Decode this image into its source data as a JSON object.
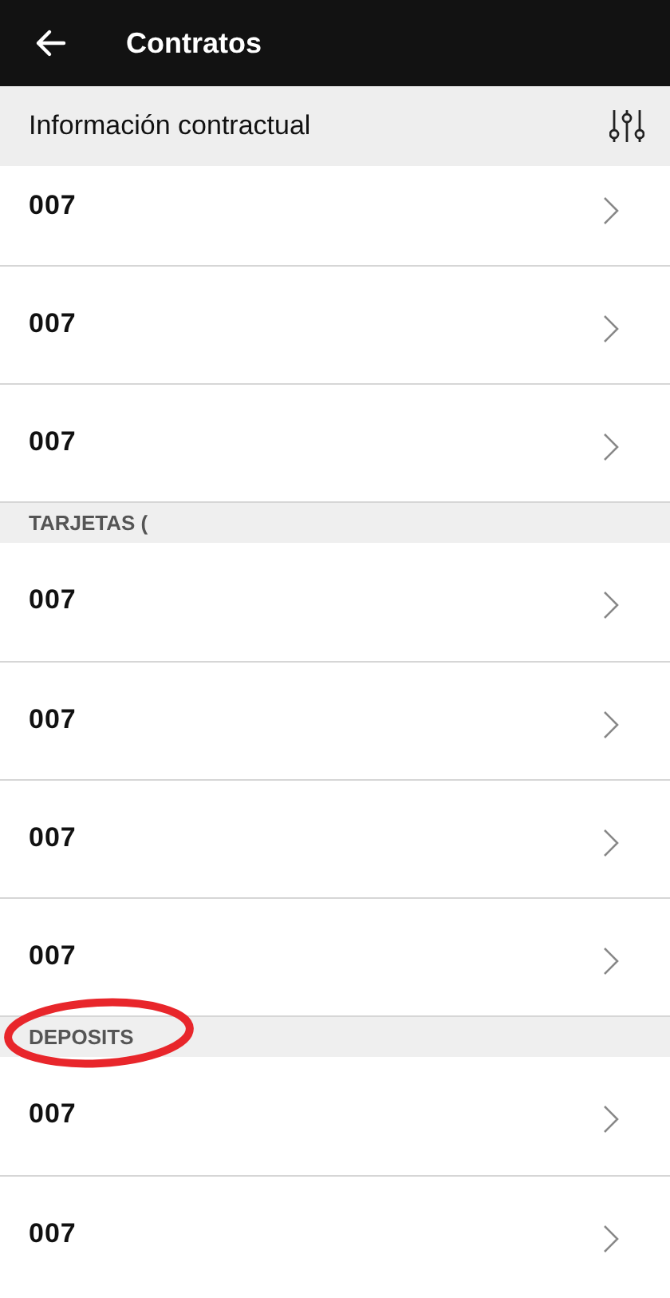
{
  "app_bar": {
    "title": "Contratos"
  },
  "subheader": {
    "title": "Información contractual"
  },
  "groups": [
    {
      "highlighted": false,
      "rows": [
        {
          "number": "007"
        },
        {
          "number": "007"
        },
        {
          "number": "007"
        }
      ]
    },
    {
      "heading": "TARJETAS (",
      "highlighted": false,
      "rows": [
        {
          "number": "007"
        },
        {
          "number": "007"
        },
        {
          "number": "007"
        },
        {
          "number": "007"
        }
      ]
    },
    {
      "heading": "DEPOSITS",
      "highlighted": true,
      "rows": [
        {
          "number": "007"
        },
        {
          "number": "007"
        }
      ]
    }
  ]
}
